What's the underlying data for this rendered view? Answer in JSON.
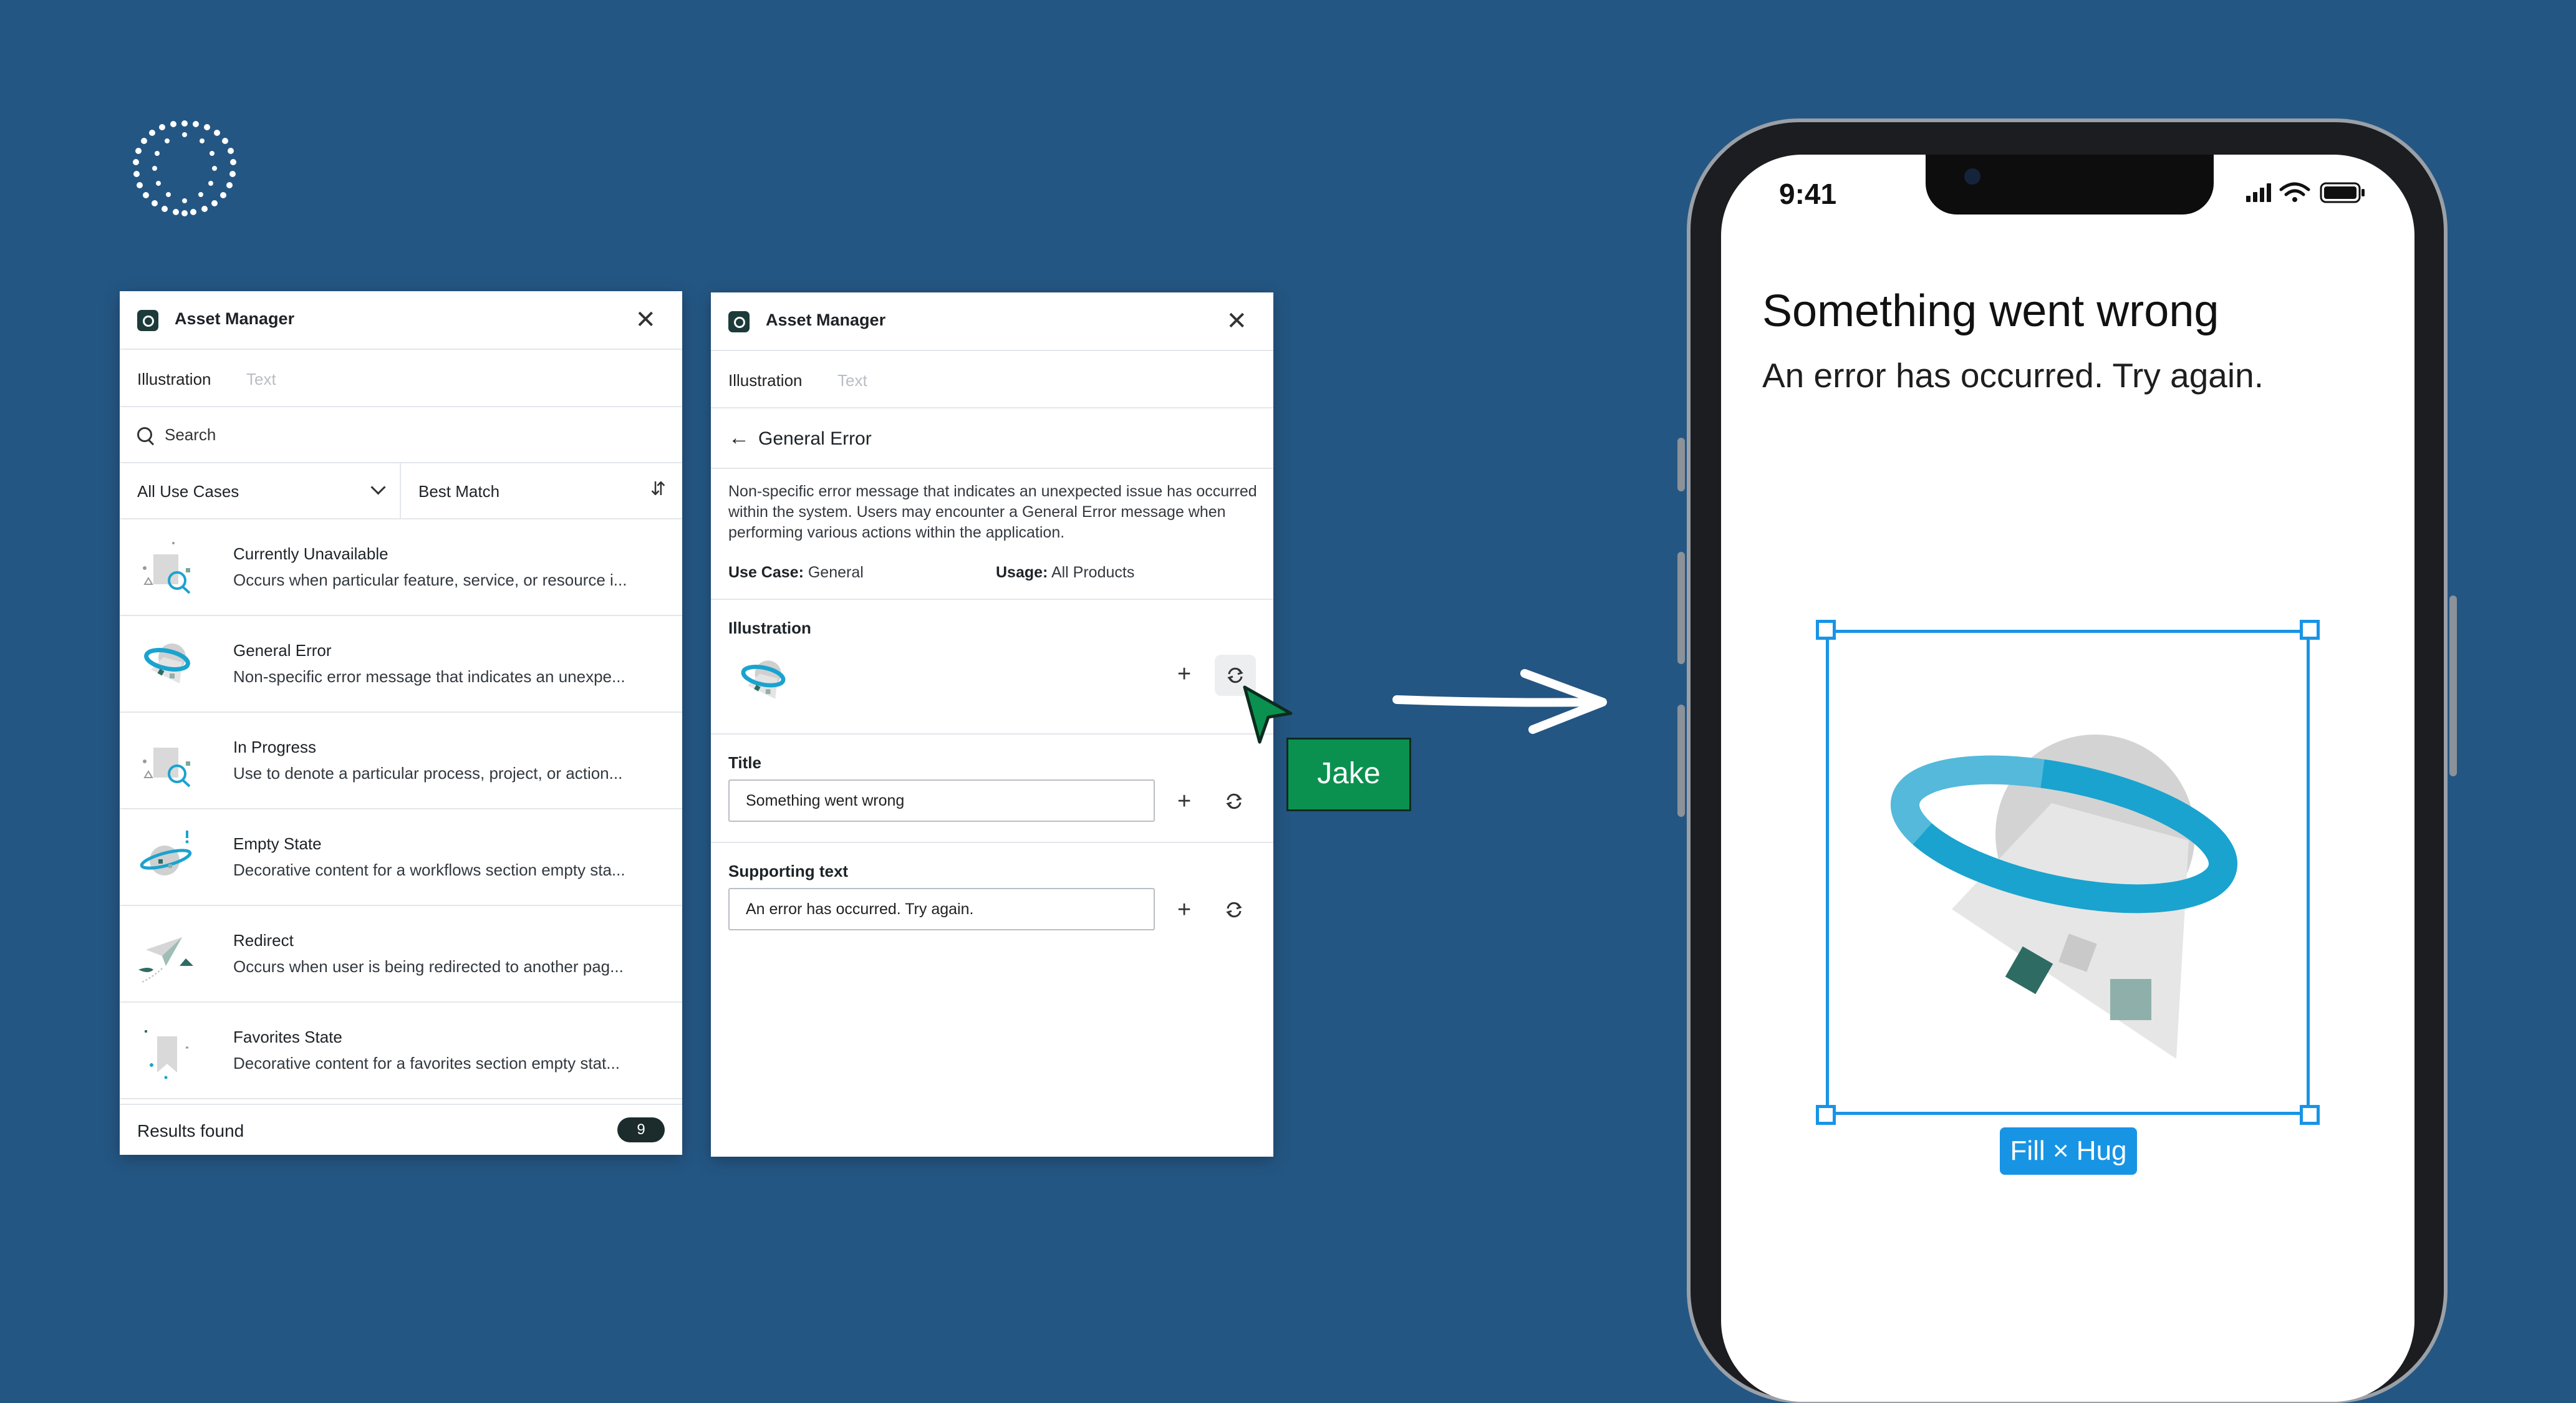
{
  "panel_left": {
    "header_title": "Asset Manager",
    "tabs": [
      {
        "label": "Illustration"
      },
      {
        "label": "Text"
      }
    ],
    "search_placeholder": "Search",
    "filter_use_case": "All Use Cases",
    "filter_sort": "Best Match",
    "items": [
      {
        "title": "Currently Unavailable",
        "desc": "Occurs when particular feature, service, or resource i...",
        "icon": "magnifier-illustration-icon"
      },
      {
        "title": "General Error",
        "desc": "Non-specific error message that indicates an unexpe...",
        "icon": "ufo-illustration-icon"
      },
      {
        "title": "In Progress",
        "desc": "Use to denote a particular process, project, or action...",
        "icon": "magnifier-illustration-icon"
      },
      {
        "title": "Empty State",
        "desc": "Decorative content for a workflows section empty sta...",
        "icon": "planet-illustration-icon"
      },
      {
        "title": "Redirect",
        "desc": "Occurs when user is being redirected to another pag...",
        "icon": "paper-plane-illustration-icon"
      },
      {
        "title": "Favorites State",
        "desc": "Decorative content for a favorites section empty stat...",
        "icon": "bookmark-illustration-icon"
      }
    ],
    "results_label": "Results found",
    "results_count": "9"
  },
  "panel_right": {
    "header_title": "Asset Manager",
    "tabs": [
      {
        "label": "Illustration"
      },
      {
        "label": "Text"
      }
    ],
    "back_title": "General Error",
    "description": "Non-specific error message that indicates an unexpected issue has occurred within the system. Users may encounter a General Error message when performing various actions within the application.",
    "use_case_label": "Use Case:",
    "use_case_value": "General",
    "usage_label": "Usage:",
    "usage_value": "All Products",
    "illustration_label": "Illustration",
    "title_label": "Title",
    "title_value": "Something went wrong",
    "supporting_label": "Supporting text",
    "supporting_value": "An error has occurred. Try again."
  },
  "collaborator": {
    "name": "Jake",
    "color": "#0a9150"
  },
  "phone": {
    "time": "9:41",
    "title": "Something went wrong",
    "subtitle": "An error has occurred. Try again.",
    "selection_tag": "Fill × Hug"
  },
  "colors": {
    "background": "#245683",
    "accent": "#1894e5",
    "illustration_ring": "#1aa3cf"
  }
}
